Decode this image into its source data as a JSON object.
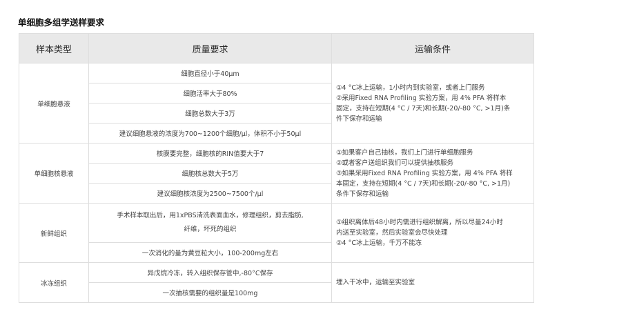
{
  "title": "单细胞多组学送样要求",
  "headers": [
    "样本类型",
    "质量要求",
    "运输条件"
  ],
  "groups": [
    {
      "type": "单细胞悬液",
      "quality": [
        "细胞直径小于40μm",
        "细胞活率大于80%",
        "细胞总数大于3万",
        "建议细胞悬液的浓度为700~1200个细胞/μl，体积不小于50μl"
      ],
      "transport": [
        "①4 °C冰上运输，1小时内到实验室，或者上门服务",
        "②采用Fixed RNA Profiling 实验方案，用 4% PFA 将样本",
        "固定，支持在短期(4 °C / 7天)和长期(-20/-80 °C, >1月)条",
        "件下保存和运输"
      ]
    },
    {
      "type": "单细胞核悬液",
      "quality": [
        "核膜要完整，细胞核的RIN值要大于7",
        "细胞核总数大于5万",
        "建议细胞核浓度为2500~7500个/μl"
      ],
      "transport": [
        "①如果客户自己抽核，我们上门进行单细胞服务",
        "②或者客户送组织我们可以提供抽核服务",
        "③如果采用Fixed RNA Profiling 实验方案，用 4% PFA 将样",
        "本固定，支持在短期(4 °C / 7天)和长期(-20/-80 °C, >1月)",
        "条件下保存和运输"
      ]
    },
    {
      "type": "新鲜组织",
      "quality": [
        "手术样本取出后，用1xPBS清洗表面血水，修理组织，剪去脂肪,",
        "纤维，坏死的组织",
        "一次消化的量为黄豆粒大小，100-200mg左右"
      ],
      "transport": [
        "①组织离体后48小时内需进行组织解离，所以尽量24小时",
        "内送至实验室，然后实验室会尽快处理",
        "②4 °C冰上运输，千万不能冻"
      ]
    },
    {
      "type": "冰冻组织",
      "quality": [
        "异戊烷冷冻，转入组织保存管中,-80°C保存",
        "一次抽核需要的组织量是100mg"
      ],
      "transport": [
        "埋入干冰中，运输至实验室"
      ]
    }
  ]
}
